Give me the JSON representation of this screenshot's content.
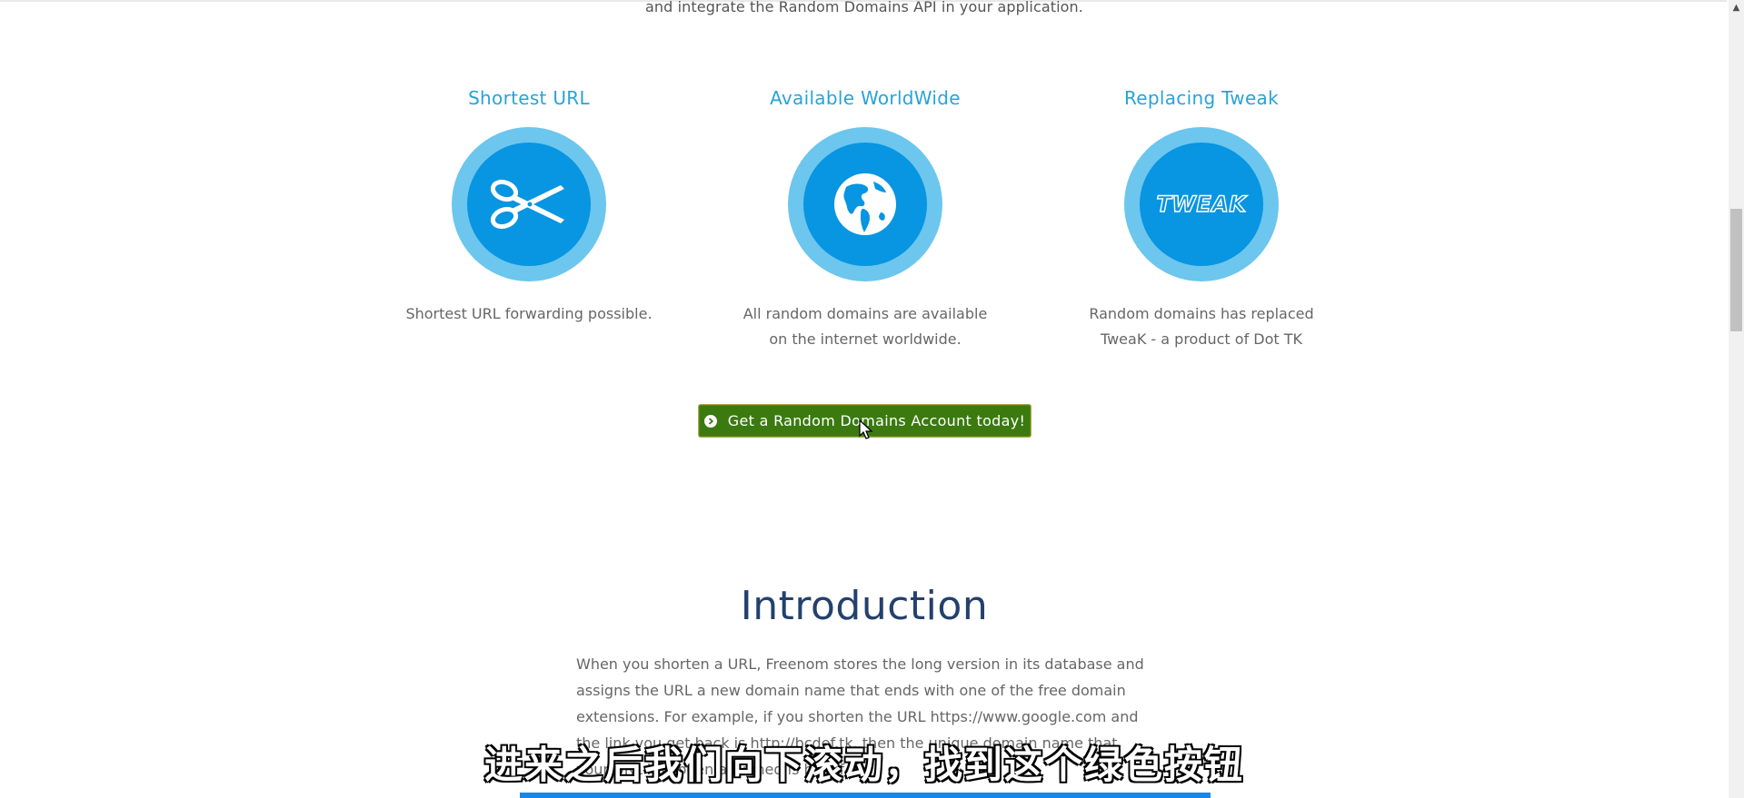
{
  "intro_tail": "and integrate the Random Domains API in your application.",
  "features": [
    {
      "title": "Shortest URL",
      "icon": "scissors-icon",
      "description": "Shortest URL forwarding possible."
    },
    {
      "title": "Available WorldWide",
      "icon": "globe-icon",
      "description": "All random domains are available on the internet worldwide."
    },
    {
      "title": "Replacing Tweak",
      "icon": "tweak-logo",
      "icon_text": "TWEAK",
      "description": "Random domains has replaced TweaK - a product of Dot TK"
    }
  ],
  "cta": {
    "label": "Get a Random Domains Account today!",
    "icon": "chevron-circle-right-icon"
  },
  "introduction": {
    "title": "Introduction",
    "body": "When you shorten a URL, Freenom stores the long version in its database and assigns the URL a new domain name that ends with one of the free domain extensions. For example, if you shorten the URL https://www.google.com and the link you get back is http://bcdef.tk, then the unique domain name that your URL has been assigned is bcdef.tk."
  },
  "subtitle": "进来之后我们向下滚动，找到这个绿色按钮",
  "colors": {
    "feature_title": "#29a3d8",
    "circle_outer": "#6cc6ee",
    "circle_inner": "#0895e1",
    "cta_background": "#3a7a0e",
    "intro_title": "#23406e"
  }
}
